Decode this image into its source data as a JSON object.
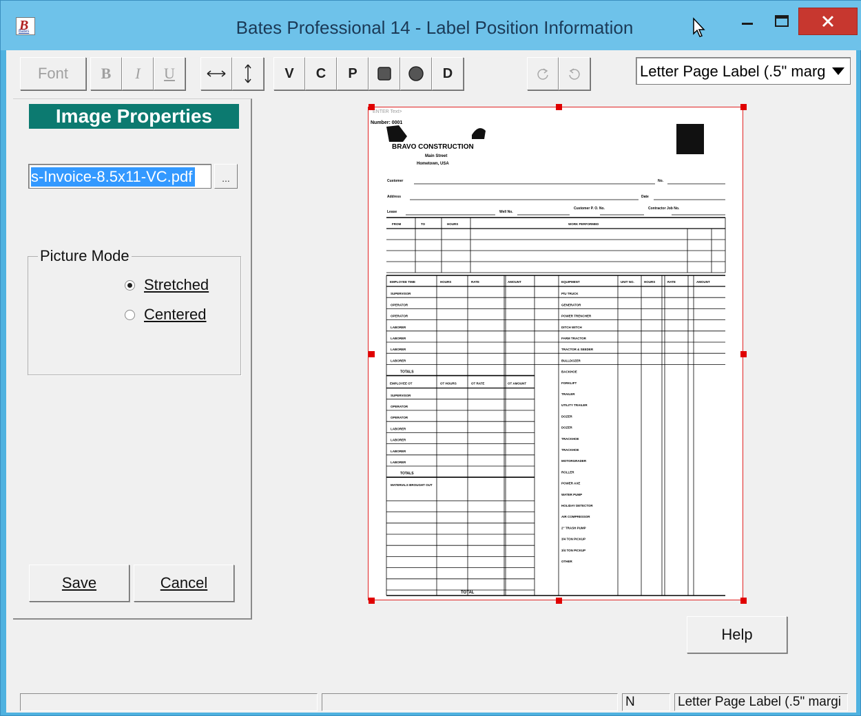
{
  "window": {
    "title": "Bates Professional 14 - Label Position Information",
    "icon_letter": "B",
    "icon_caption": "Bates"
  },
  "toolbar": {
    "font_label": "Font",
    "bold_label": "B",
    "italic_label": "I",
    "underline_label": "U",
    "v_label": "V",
    "c_label": "C",
    "p_label": "P",
    "d_label": "D",
    "label_combo_value": "Letter Page Label (.5\" margi"
  },
  "panel": {
    "header": "Image Properties",
    "file_value": "s-Invoice-8.5x11-VC.pdf",
    "browse_label": "...",
    "picture_mode": {
      "label": "Picture Mode",
      "options": [
        {
          "label": "Stretched",
          "checked": true
        },
        {
          "label": "Centered",
          "checked": false
        }
      ]
    },
    "save_label": "Save",
    "cancel_label": "Cancel"
  },
  "help_label": "Help",
  "document": {
    "enter_text": "ENTER Text>",
    "number_text": "Number: 0001",
    "company": "BRAVO CONSTRUCTION",
    "address1": "Main Street",
    "address2": "Hometown, USA",
    "fields": {
      "customer": "Customer",
      "no": "No.",
      "address": "Address",
      "date": "Date",
      "lease": "Lease",
      "well_no": "Well No.",
      "customer_po": "Customer P. O. No.",
      "contractor_job": "Contractor Job No."
    },
    "work_table_headers": [
      "FROM",
      "TO",
      "HOURS",
      "WORK PERFORMED"
    ],
    "employee_headers": [
      "EMPLOYEE TIME",
      "HOURS",
      "RATE",
      "AMOUNT"
    ],
    "employee_rows": [
      "SUPERVISOR",
      "OPERATOR",
      "OPERATOR",
      "LABORER",
      "LABORER",
      "LABORER",
      "LABORER"
    ],
    "employee_total": "TOTALS",
    "ot_headers": [
      "EMPLOYEE OT",
      "OT HOURS",
      "OT RATE",
      "OT AMOUNT"
    ],
    "ot_rows": [
      "SUPERVISOR",
      "OPERATOR",
      "OPERATOR",
      "LABORER",
      "LABORER",
      "LABORER",
      "LABORER"
    ],
    "ot_total": "TOTALS",
    "materials_header": "MATERIALS BROUGHT OUT",
    "materials_total": "TOTAL",
    "equipment_headers": [
      "EQUIPMENT",
      "UNIT NO.",
      "HOURS",
      "RATE",
      "AMOUNT"
    ],
    "equipment_rows": [
      "P/U TRUCK",
      "GENERATOR",
      "POWER TRENCHER",
      "DITCH WITCH",
      "FARM TRACTOR",
      "TRACTOR & SEEDER",
      "BULLDOZER",
      "BACKHOE",
      "FORKLIFT",
      "TRAILER",
      "UTILITY TRAILER",
      "DOZER",
      "DOZER",
      "TRACKHOE",
      "TRACKHOE",
      "MOTORGRADER",
      "ROLLER",
      "POWER AXE",
      "WATER PUMP",
      "HOLIDAY DETECTOR",
      "AIR COMPRESSOR",
      "2\" TRASH PUMP",
      "3/4 TON PICKUP",
      "3/4 TON PICKUP",
      "OTHER"
    ]
  },
  "status": {
    "cell1": "",
    "cell2": "",
    "cell3": "N",
    "cell4": "Letter Page Label (.5\" margi"
  }
}
